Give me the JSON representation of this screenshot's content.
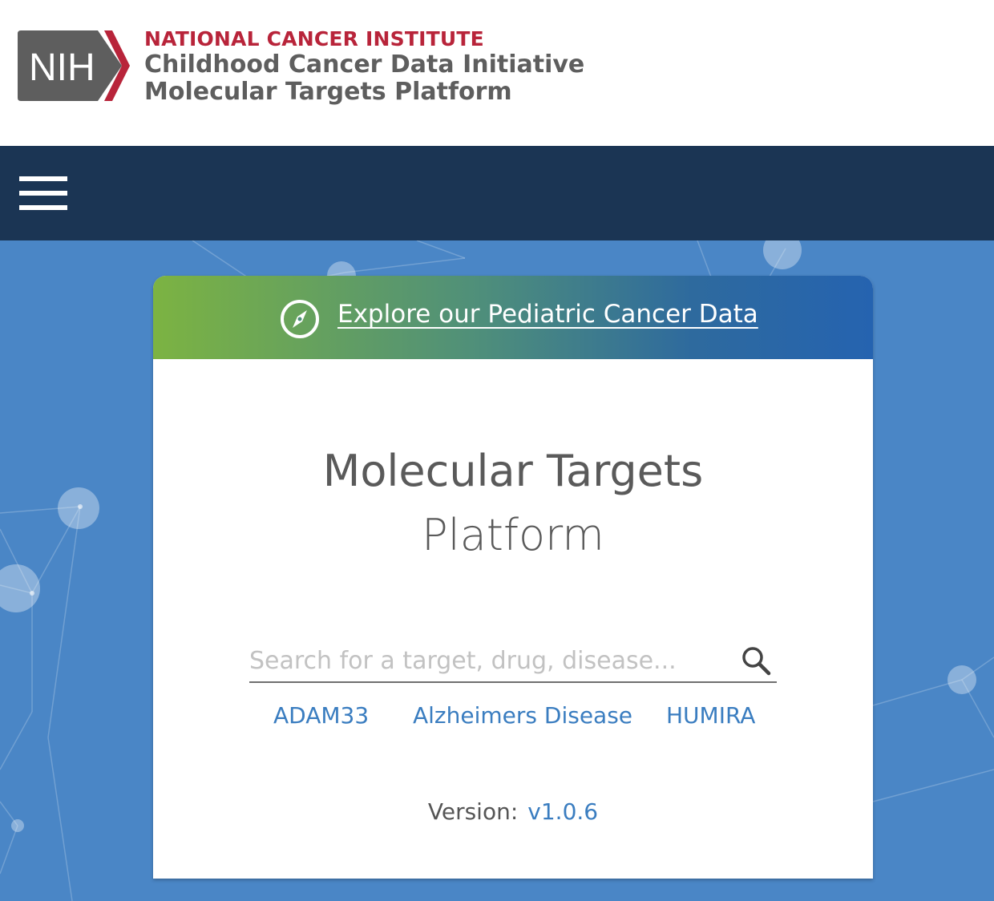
{
  "header": {
    "logo_text": "NIH",
    "org_name": "NATIONAL CANCER INSTITUTE",
    "initiative": "Childhood Cancer Data Initiative",
    "platform": "Molecular Targets Platform",
    "colors": {
      "org_red": "#b8243a",
      "logo_grey": "#5e5e5e"
    }
  },
  "navbar": {
    "menu_icon": "hamburger-menu-icon",
    "background": "#1b3554"
  },
  "hero": {
    "background": "#4a86c6",
    "banner": {
      "icon": "compass-icon",
      "link_text": "Explore our Pediatric Cancer Data",
      "gradient_colors": [
        "#7cb342",
        "#2563b0"
      ]
    },
    "title_line1": "Molecular Targets",
    "title_line2": "Platform",
    "search": {
      "placeholder": "Search for a target, drug, disease...",
      "value": "",
      "icon": "search-icon"
    },
    "suggestions": [
      "ADAM33",
      "Alzheimers Disease",
      "HUMIRA"
    ],
    "version_label": "Version:",
    "version_number": "v1.0.6",
    "link_color": "#3a7dc0"
  }
}
